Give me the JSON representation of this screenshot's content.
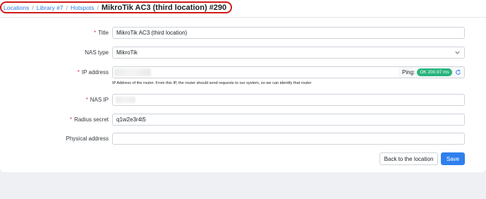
{
  "breadcrumb": {
    "items": [
      "Locations",
      "Library #7",
      "Hotspots"
    ],
    "separator": "/",
    "current": "MikroTik AC3 (third location) #290"
  },
  "form": {
    "title": {
      "label": "Title",
      "required": "*",
      "value": "MikroTik AC3 (third location)"
    },
    "nas_type": {
      "label": "NAS type",
      "value": "MikroTik"
    },
    "ip_address": {
      "label": "IP address",
      "required": "*",
      "value": "",
      "ping_label": "Ping:",
      "ping_status": "OK 200.97 ms",
      "help": "IP Address of the router. From this IP, the router should send requests to our system, so we can identify that router"
    },
    "nas_ip": {
      "label": "NAS IP",
      "required": "*",
      "value": ""
    },
    "radius_secret": {
      "label": "Radius secret",
      "required": "*",
      "value": "q1w2e3r4t5"
    },
    "physical_address": {
      "label": "Physical address",
      "value": ""
    }
  },
  "buttons": {
    "back": "Back to the location",
    "save": "Save"
  },
  "colors": {
    "accent": "#2f80ed",
    "ping_ok": "#28b47d",
    "required": "#dc3545",
    "highlight": "#d11a1a"
  },
  "icons": [
    "chevron-down-icon",
    "refresh-icon"
  ]
}
